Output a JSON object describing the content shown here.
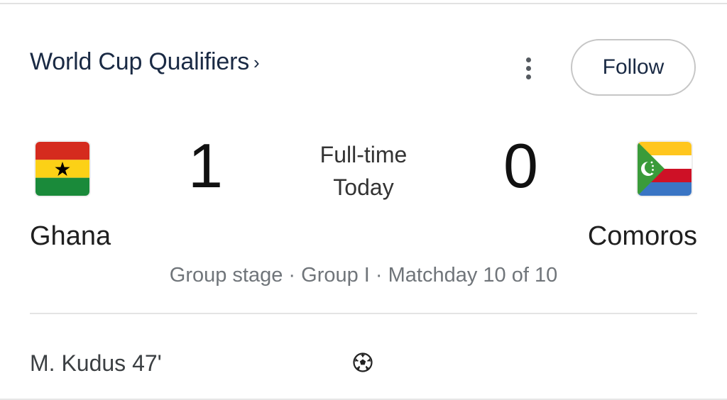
{
  "header": {
    "competition": "World Cup Qualifiers",
    "chevron": "›",
    "more_icon": "more-vert-icon",
    "follow_label": "Follow"
  },
  "match": {
    "home": {
      "name": "Ghana",
      "score": "1",
      "flag": "ghana-flag-icon"
    },
    "away": {
      "name": "Comoros",
      "score": "0",
      "flag": "comoros-flag-icon"
    },
    "status": "Full-time",
    "date": "Today",
    "info": "Group stage · Group I · Matchday 10 of 10"
  },
  "events": [
    {
      "scorer": "M. Kudus 47'",
      "icon": "soccer-ball-icon"
    }
  ],
  "colors": {
    "title": "#1a2a44",
    "secondary_text": "#70757a",
    "ghana_red": "#d52b1e",
    "ghana_yellow": "#fcd116",
    "ghana_green": "#1a8a3a",
    "comoros_yellow": "#ffc61e",
    "comoros_white": "#ffffff",
    "comoros_red": "#ce1126",
    "comoros_blue": "#3a75c4",
    "comoros_green": "#3a9b3a"
  }
}
